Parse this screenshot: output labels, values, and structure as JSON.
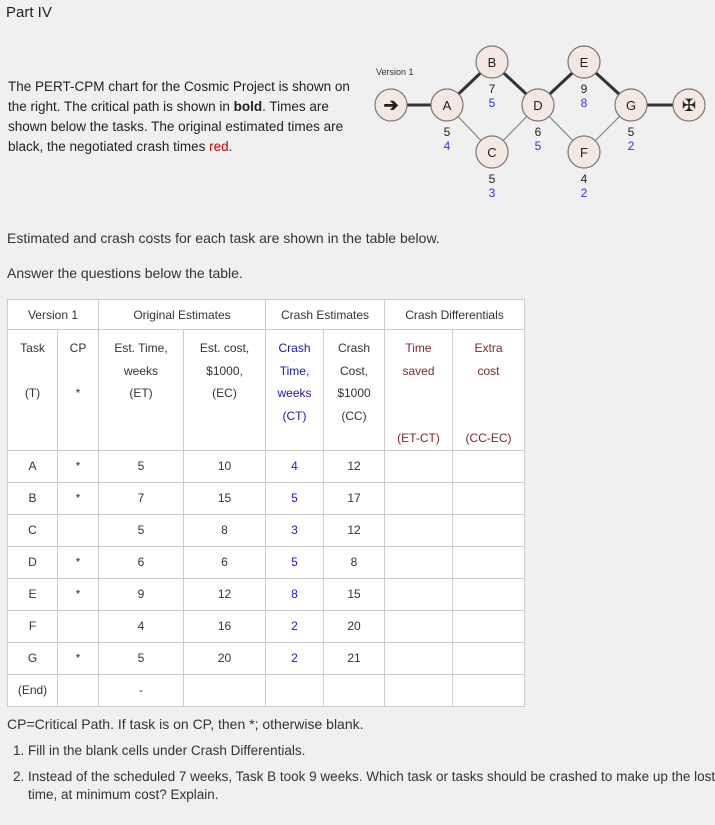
{
  "title": "Part IV",
  "intro": {
    "t1": "The PERT-CPM chart for the Cosmic Project is shown on the right. The critical path is shown in ",
    "bold": "bold",
    "t2": ". Times are shown below the tasks. The original estimated times are black, the negotiated crash times ",
    "red": "red",
    "t3": "."
  },
  "diagram": {
    "label": "Version 1",
    "nodes": [
      {
        "id": "A",
        "et": "5",
        "ct": "4"
      },
      {
        "id": "B",
        "et": "7",
        "ct": "5"
      },
      {
        "id": "C",
        "et": "5",
        "ct": "3"
      },
      {
        "id": "D",
        "et": "6",
        "ct": "5"
      },
      {
        "id": "E",
        "et": "9",
        "ct": "8"
      },
      {
        "id": "F",
        "et": "4",
        "ct": "2"
      },
      {
        "id": "G",
        "et": "5",
        "ct": "2"
      }
    ],
    "start_icon": "arrow-right-icon",
    "end_icon": "finish-cross-icon"
  },
  "p1": "Estimated and crash costs for each task are shown in the table below.",
  "p2": "Answer the questions below the table.",
  "table": {
    "groups": [
      "Version 1",
      "Original Estimates",
      "Crash Estimates",
      "Crash Differentials"
    ],
    "headers": [
      [
        "Task",
        "(T)"
      ],
      [
        "CP",
        "*"
      ],
      [
        "Est. Time,",
        "weeks",
        "(ET)"
      ],
      [
        "Est. cost,",
        "$1000,",
        "(EC)"
      ],
      [
        "Crash",
        "Time,",
        "weeks",
        "(CT)"
      ],
      [
        "Crash",
        "Cost,",
        "$1000",
        "(CC)"
      ],
      [
        "Time",
        "saved",
        "(ET-CT)"
      ],
      [
        "Extra",
        "cost",
        "(CC-EC)"
      ]
    ],
    "rows": [
      [
        "A",
        "*",
        "5",
        "10",
        "4",
        "12",
        "",
        ""
      ],
      [
        "B",
        "*",
        "7",
        "15",
        "5",
        "17",
        "",
        ""
      ],
      [
        "C",
        "",
        "5",
        "8",
        "3",
        "12",
        "",
        ""
      ],
      [
        "D",
        "*",
        "6",
        "6",
        "5",
        "8",
        "",
        ""
      ],
      [
        "E",
        "*",
        "9",
        "12",
        "8",
        "15",
        "",
        ""
      ],
      [
        "F",
        "",
        "4",
        "16",
        "2",
        "20",
        "",
        ""
      ],
      [
        "G",
        "*",
        "5",
        "20",
        "2",
        "21",
        "",
        ""
      ],
      [
        "(End)",
        "",
        "-",
        "",
        "",
        "",
        "",
        ""
      ]
    ]
  },
  "note": "CP=Critical Path. If task is on CP, then *; otherwise blank.",
  "questions": [
    "Fill in the blank cells under Crash Differentials.",
    "Instead of the scheduled 7 weeks, Task B took 9 weeks. Which task or tasks should be crashed to make up the lost time, at minimum cost? Explain."
  ]
}
